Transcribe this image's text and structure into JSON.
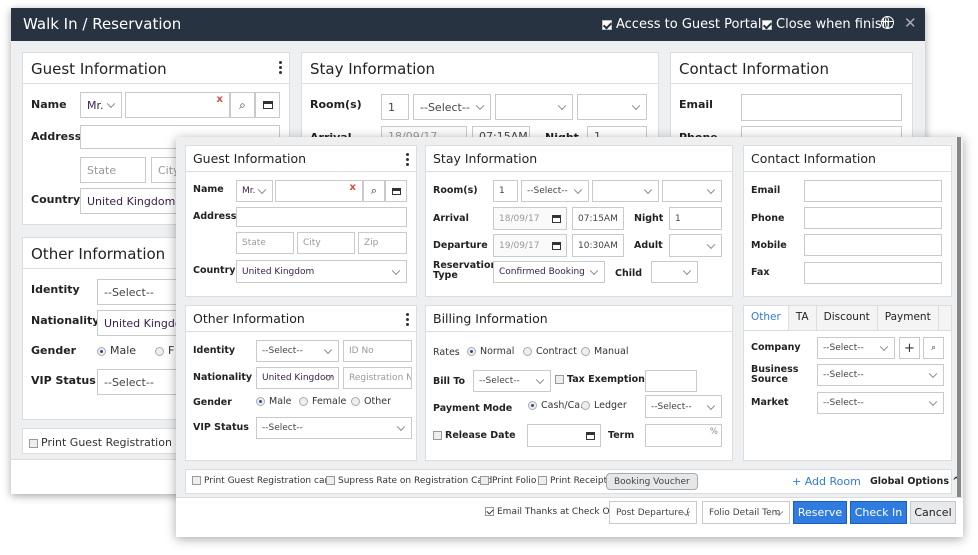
{
  "window": {
    "title": "Walk In / Reservation",
    "access_portal_label": "Access to Guest Portal",
    "access_portal_checked": true,
    "close_when_finish_label": "Close when finish.",
    "close_when_finish_checked": true,
    "globe_icon": "globe-icon",
    "close_icon": "close-icon"
  },
  "back": {
    "guest": {
      "title": "Guest Information",
      "name_label": "Name",
      "salutation": "Mr.",
      "address_label": "Address",
      "state_ph": "State",
      "city_ph": "City",
      "country_label": "Country",
      "country": "United Kingdom"
    },
    "stay": {
      "title": "Stay Information",
      "rooms_label": "Room(s)",
      "rooms": "1",
      "room_type": "--Select--",
      "arrival_label": "Arrival",
      "arrival": "18/09/17",
      "arrival_time": "07:15AM",
      "night_label": "Night",
      "night": "1"
    },
    "contact": {
      "title": "Contact Information",
      "email_label": "Email",
      "phone_label": "Phone"
    },
    "other": {
      "title": "Other Information",
      "identity_label": "Identity",
      "identity": "--Select--",
      "nationality_label": "Nationality",
      "nationality": "United Kingdom",
      "gender_label": "Gender",
      "male": "Male",
      "female_partial": "F",
      "vip_label": "VIP Status",
      "vip": "--Select--"
    },
    "print_reg_label": "Print Guest Registration card"
  },
  "front": {
    "guest": {
      "title": "Guest Information",
      "name_label": "Name",
      "salutation": "Mr.",
      "address_label": "Address",
      "state_ph": "State",
      "city_ph": "City",
      "zip_ph": "Zip",
      "country_label": "Country",
      "country": "United Kingdom"
    },
    "stay": {
      "title": "Stay Information",
      "rooms_label": "Room(s)",
      "rooms": "1",
      "room_type": "--Select--",
      "arrival_label": "Arrival",
      "arrival": "18/09/17",
      "arrival_time": "07:15AM",
      "night_label": "Night",
      "night": "1",
      "departure_label": "Departure",
      "departure": "19/09/17",
      "departure_time": "10:30AM",
      "adult_label": "Adult",
      "res_type_label_1": "Reservation",
      "res_type_label_2": "Type",
      "res_type": "Confirmed Booking",
      "child_label": "Child"
    },
    "contact": {
      "title": "Contact Information",
      "email_label": "Email",
      "phone_label": "Phone",
      "mobile_label": "Mobile",
      "fax_label": "Fax"
    },
    "other": {
      "title": "Other Information",
      "identity_label": "Identity",
      "identity": "--Select--",
      "id_no_ph": "ID No",
      "nationality_label": "Nationality",
      "nationality": "United Kingdom",
      "reg_no_ph": "Registration N",
      "gender_label": "Gender",
      "genders": [
        "Male",
        "Female",
        "Other"
      ],
      "gender_selected": "Male",
      "vip_label": "VIP Status",
      "vip": "--Select--"
    },
    "billing": {
      "title": "Billing Information",
      "rates_label": "Rates",
      "rates": [
        "Normal",
        "Contract",
        "Manual"
      ],
      "rate_selected": "Normal",
      "bill_to_label": "Bill To",
      "bill_to": "--Select--",
      "tax_exemption_label": "Tax Exemption ID",
      "payment_mode_label": "Payment Mode",
      "payment_modes": [
        "Cash/Ca...",
        "Ledger"
      ],
      "payment_selected": "Cash/Ca...",
      "payment_select": "--Select--",
      "release_date_label": "Release Date",
      "term_label": "Term",
      "term_unit": "%"
    },
    "side_tabs": {
      "tabs": [
        "Other",
        "TA",
        "Discount",
        "Payment"
      ],
      "active": "Other",
      "company_label": "Company",
      "company": "--Select--",
      "business_source_label_1": "Business",
      "business_source_label_2": "Source",
      "business_source": "--Select--",
      "market_label": "Market",
      "market": "--Select--"
    },
    "options": {
      "print_reg": "Print Guest Registration card",
      "supress_rate": "Supress Rate on Registration Card",
      "print_folio": "Print Folio",
      "print_receipt": "Print Receipt",
      "booking_voucher": "Booking Voucher",
      "add_room": "+ Add Room",
      "global_options": "Global Options"
    },
    "footer": {
      "email_thanks": "Email Thanks at Check Out",
      "email_thanks_checked": true,
      "post_departure": "Post Departure (",
      "folio_detail": "Folio Detail Tem",
      "reserve": "Reserve",
      "check_in": "Check In",
      "cancel": "Cancel"
    }
  }
}
